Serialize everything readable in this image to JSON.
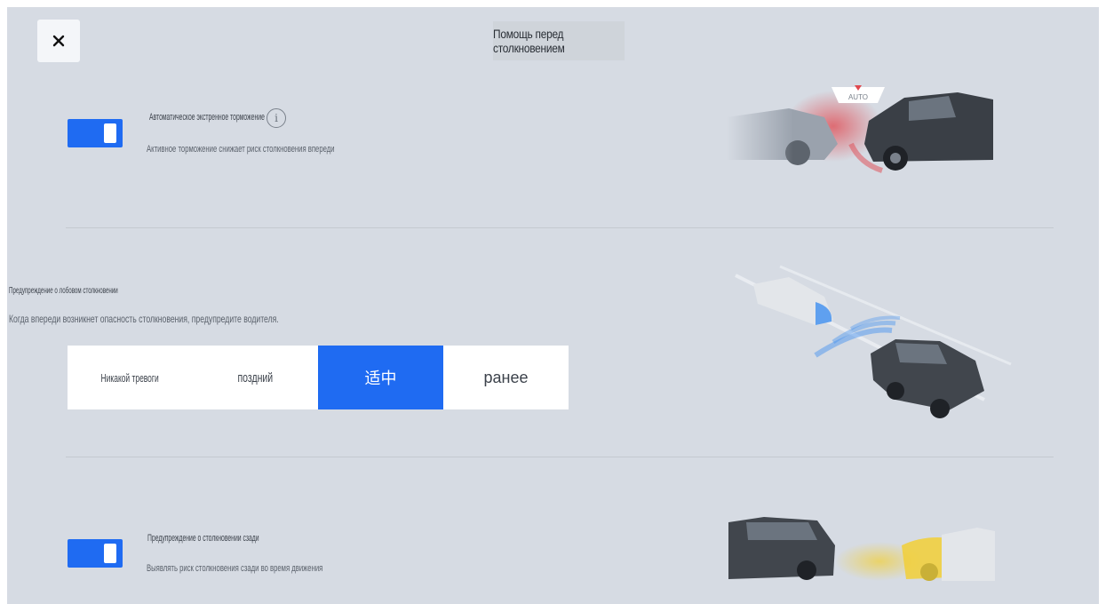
{
  "header": {
    "title": "Помощь перед столкновением",
    "close_icon": "close-icon"
  },
  "aeb": {
    "title": "Автоматическое экстренное торможение",
    "desc": "Активное торможение снижает риск столкновения впереди",
    "enabled": true,
    "badge": "AUTO"
  },
  "fcw": {
    "title": "Предупреждение о лобовом столкновении",
    "desc": "Когда впереди возникнет опасность столкновения, предупредите водителя.",
    "options": [
      "Никакой тревоги",
      "поздний",
      "适中",
      "ранее"
    ],
    "selected": "适中"
  },
  "rcw": {
    "title": "Предупреждение о столкновении сзади",
    "desc": "Выявлять риск столкновения сзади во время движения",
    "enabled": true
  },
  "colors": {
    "accent": "#1f6bf2",
    "background": "#d6dbe3",
    "warning_red": "#e0484f",
    "warning_yellow": "#f2cf36",
    "radar_blue": "#3d8ef0"
  }
}
